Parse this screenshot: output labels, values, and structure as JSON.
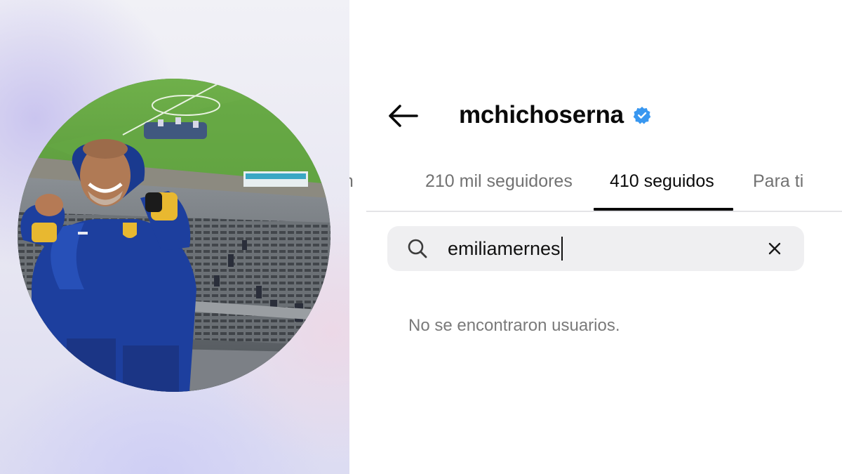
{
  "profile": {
    "username": "mchichoserna",
    "verified": true,
    "accent_color": "#3897f0"
  },
  "avatar": {
    "icon": "profile-photo"
  },
  "tabs": [
    {
      "label": "ún",
      "active": false
    },
    {
      "label": "210 mil seguidores",
      "active": false
    },
    {
      "label": "410 seguidos",
      "active": true
    },
    {
      "label": "Para ti",
      "active": false
    }
  ],
  "search": {
    "value": "emiliamernes",
    "icon": "search-icon",
    "clear_icon": "close-icon"
  },
  "results": {
    "empty_message": "No se encontraron usuarios."
  }
}
